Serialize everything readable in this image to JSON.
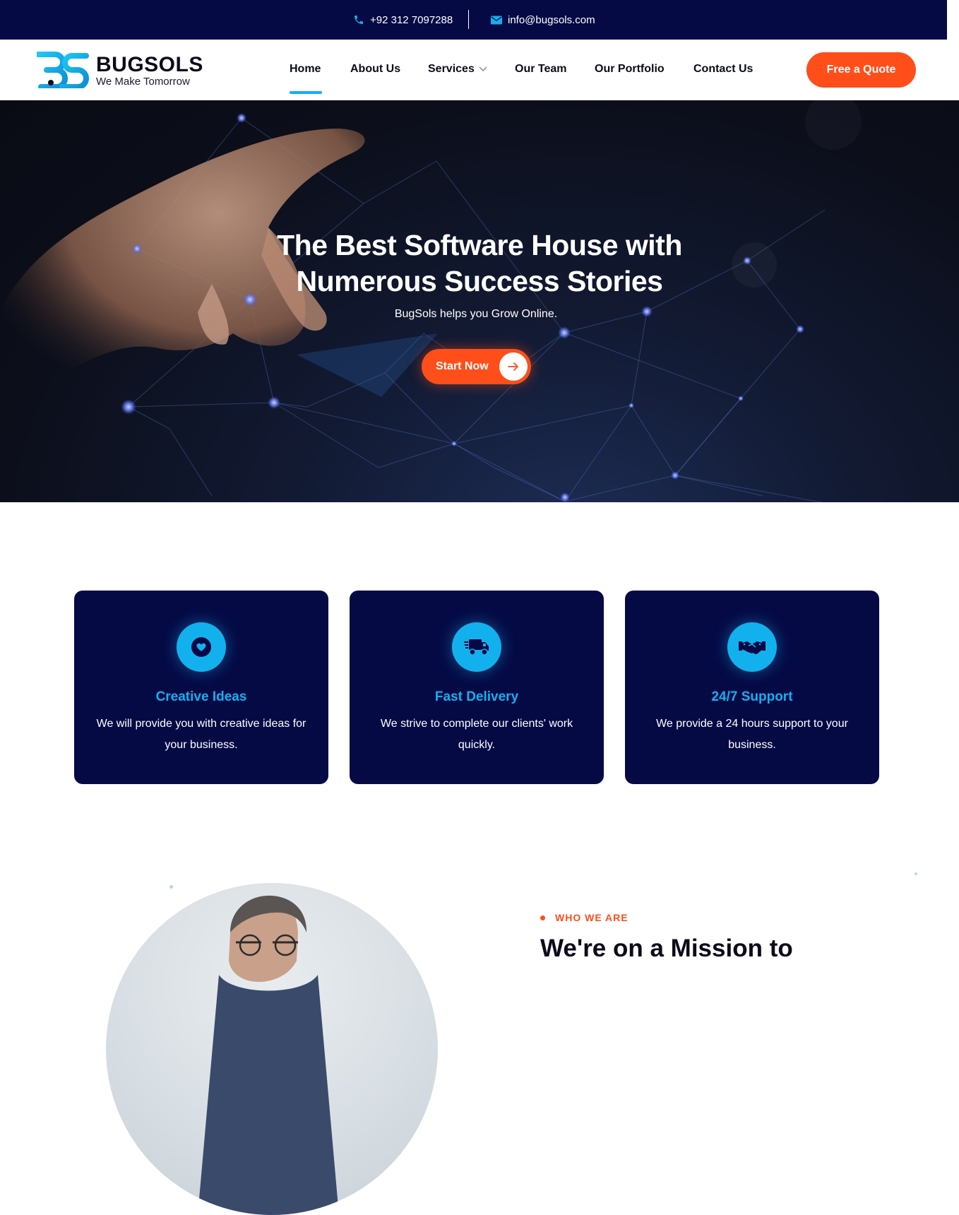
{
  "topbar": {
    "phone": "+92 312 7097288",
    "email": "info@bugsols.com",
    "phone_icon": "phone-icon",
    "email_icon": "envelope-icon"
  },
  "brand": {
    "name": "BUGSOLS",
    "tagline": "We Make Tomorrow",
    "logo_icon": "bs-monogram-logo"
  },
  "nav": {
    "items": [
      {
        "label": "Home",
        "active": true
      },
      {
        "label": "About Us"
      },
      {
        "label": "Services",
        "has_dropdown": true
      },
      {
        "label": "Our Team"
      },
      {
        "label": "Our Portfolio"
      },
      {
        "label": "Contact Us"
      }
    ],
    "cta": "Free a Quote"
  },
  "hero": {
    "title_line1": "The Best Software House with",
    "title_line2": "Numerous Success Stories",
    "subtitle": "BugSols helps you Grow Online.",
    "button": "Start Now",
    "button_icon": "arrow-right-icon"
  },
  "features": [
    {
      "icon": "heart-icon",
      "title": "Creative Ideas",
      "description": "We will provide you with creative ideas for your business."
    },
    {
      "icon": "delivery-truck-icon",
      "title": "Fast Delivery",
      "description": "We strive to complete our clients' work quickly."
    },
    {
      "icon": "handshake-icon",
      "title": "24/7 Support",
      "description": "We provide a 24 hours support to your business."
    }
  ],
  "about": {
    "label": "WHO WE ARE",
    "heading": "We're on a Mission to"
  },
  "colors": {
    "navy": "#050a45",
    "accent_blue": "#13b0ee",
    "accent_orange": "#ff4e1a",
    "text_dark": "#0b0b1a"
  }
}
